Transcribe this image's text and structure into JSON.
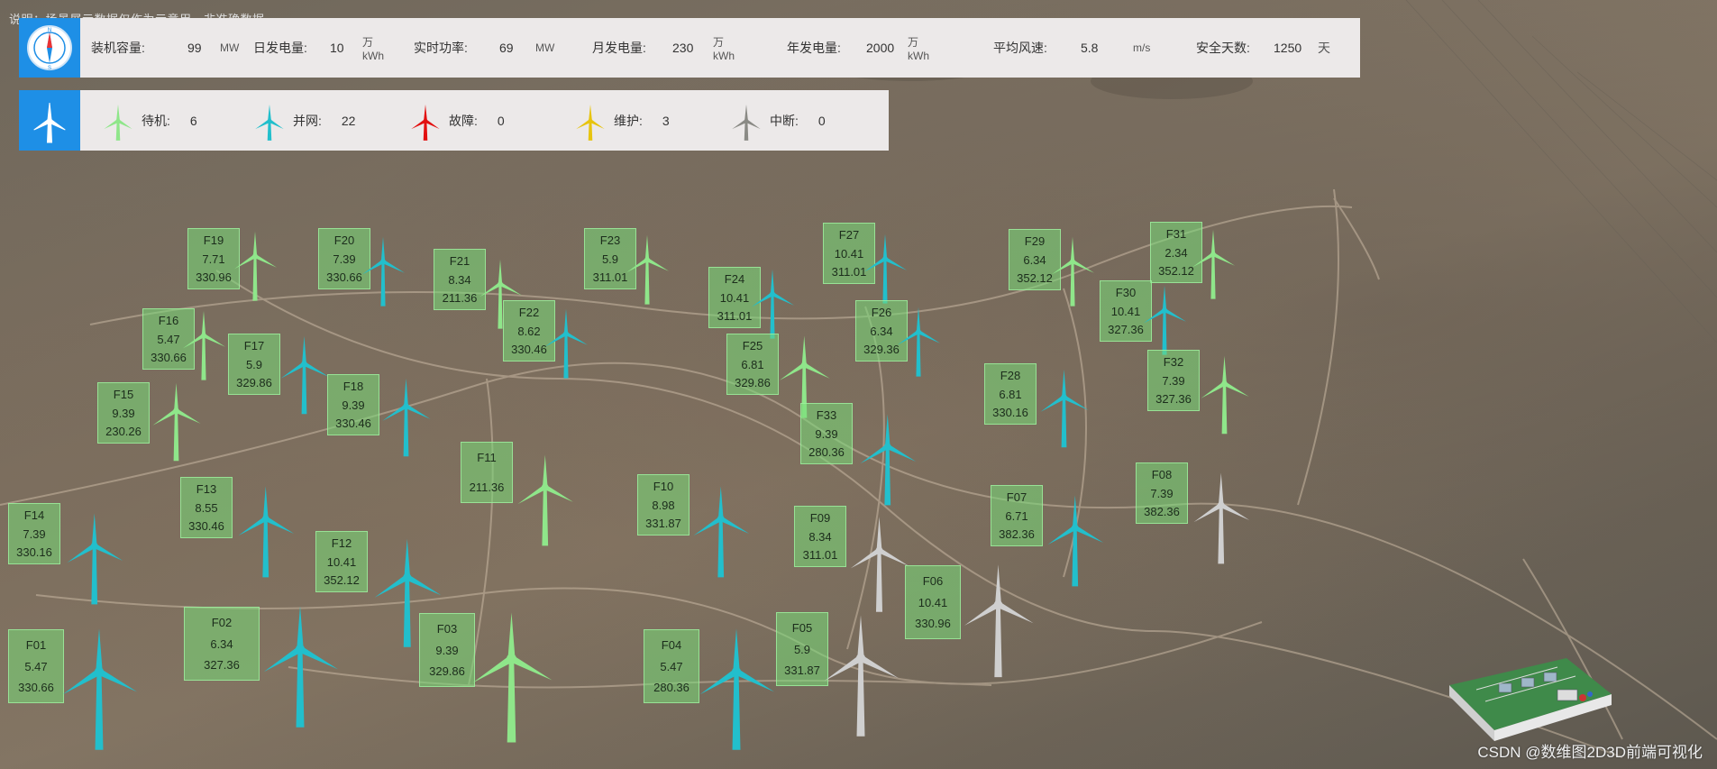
{
  "notice": "说明：场景展示数据仅作为示意用，非准确数据",
  "colors": {
    "standby": "#8fe68a",
    "grid": "#22bfcc",
    "fault": "#e21010",
    "maint": "#e7c40f",
    "offline": "#8a8a85",
    "stopped": "#cfcfcf",
    "accent": "#1e8fe6"
  },
  "stats": {
    "capacity": {
      "label": "装机容量:",
      "value": "99",
      "unit": "MW"
    },
    "daily": {
      "label": "日发电量:",
      "value": "10",
      "unit": "万kWh"
    },
    "power": {
      "label": "实时功率:",
      "value": "69",
      "unit": "MW"
    },
    "monthly": {
      "label": "月发电量:",
      "value": "230",
      "unit": "万kWh"
    },
    "yearly": {
      "label": "年发电量:",
      "value": "2000",
      "unit": "万kWh"
    },
    "wind": {
      "label": "平均风速:",
      "value": "5.8",
      "unit": "m/s"
    },
    "safe": {
      "label": "安全天数:",
      "value": "1250",
      "unit": "天"
    }
  },
  "legend": {
    "standby": {
      "label": "待机:",
      "count": "6"
    },
    "grid": {
      "label": "并网:",
      "count": "22"
    },
    "fault": {
      "label": "故障:",
      "count": "0"
    },
    "maint": {
      "label": "维护:",
      "count": "3"
    },
    "offline": {
      "label": "中断:",
      "count": "0"
    }
  },
  "turbines": [
    {
      "id": "F19",
      "wind": "7.71",
      "power": "330.96",
      "status": "standby"
    },
    {
      "id": "F20",
      "wind": "7.39",
      "power": "330.66",
      "status": "grid"
    },
    {
      "id": "F21",
      "wind": "8.34",
      "power": "211.36",
      "status": "standby"
    },
    {
      "id": "F22",
      "wind": "8.62",
      "power": "330.46",
      "status": "grid"
    },
    {
      "id": "F23",
      "wind": "5.9",
      "power": "311.01",
      "status": "standby"
    },
    {
      "id": "F24",
      "wind": "10.41",
      "power": "311.01",
      "status": "grid"
    },
    {
      "id": "F27",
      "wind": "10.41",
      "power": "311.01",
      "status": "grid"
    },
    {
      "id": "F26",
      "wind": "6.34",
      "power": "329.36",
      "status": "grid"
    },
    {
      "id": "F29",
      "wind": "6.34",
      "power": "352.12",
      "status": "standby"
    },
    {
      "id": "F31",
      "wind": "2.34",
      "power": "352.12",
      "status": "standby"
    },
    {
      "id": "F30",
      "wind": "10.41",
      "power": "327.36",
      "status": "grid"
    },
    {
      "id": "F16",
      "wind": "5.47",
      "power": "330.66",
      "status": "standby"
    },
    {
      "id": "F17",
      "wind": "5.9",
      "power": "329.86",
      "status": "grid"
    },
    {
      "id": "F25",
      "wind": "6.81",
      "power": "329.86",
      "status": "standby"
    },
    {
      "id": "F32",
      "wind": "7.39",
      "power": "327.36",
      "status": "standby"
    },
    {
      "id": "F15",
      "wind": "9.39",
      "power": "230.26",
      "status": "standby"
    },
    {
      "id": "F18",
      "wind": "9.39",
      "power": "330.46",
      "status": "grid"
    },
    {
      "id": "F28",
      "wind": "6.81",
      "power": "330.16",
      "status": "grid"
    },
    {
      "id": "F33",
      "wind": "9.39",
      "power": "280.36",
      "status": "grid"
    },
    {
      "id": "F11",
      "wind": "",
      "power": "211.36",
      "status": "standby"
    },
    {
      "id": "F08",
      "wind": "7.39",
      "power": "382.36",
      "status": "stopped"
    },
    {
      "id": "F13",
      "wind": "8.55",
      "power": "330.46",
      "status": "grid"
    },
    {
      "id": "F10",
      "wind": "8.98",
      "power": "331.87",
      "status": "grid"
    },
    {
      "id": "F07",
      "wind": "6.71",
      "power": "382.36",
      "status": "grid"
    },
    {
      "id": "F14",
      "wind": "7.39",
      "power": "330.16",
      "status": "grid"
    },
    {
      "id": "F09",
      "wind": "8.34",
      "power": "311.01",
      "status": "stopped"
    },
    {
      "id": "F12",
      "wind": "10.41",
      "power": "352.12",
      "status": "grid"
    },
    {
      "id": "F06",
      "wind": "10.41",
      "power": "330.96",
      "status": "stopped"
    },
    {
      "id": "F02",
      "wind": "6.34",
      "power": "327.36",
      "status": "grid"
    },
    {
      "id": "F01",
      "wind": "5.47",
      "power": "330.66",
      "status": "grid"
    },
    {
      "id": "F03",
      "wind": "9.39",
      "power": "329.86",
      "status": "standby"
    },
    {
      "id": "F04",
      "wind": "5.47",
      "power": "280.36",
      "status": "grid"
    },
    {
      "id": "F05",
      "wind": "5.9",
      "power": "331.87",
      "status": "stopped"
    }
  ],
  "watermark": "CSDN @数维图2D3D前端可视化"
}
